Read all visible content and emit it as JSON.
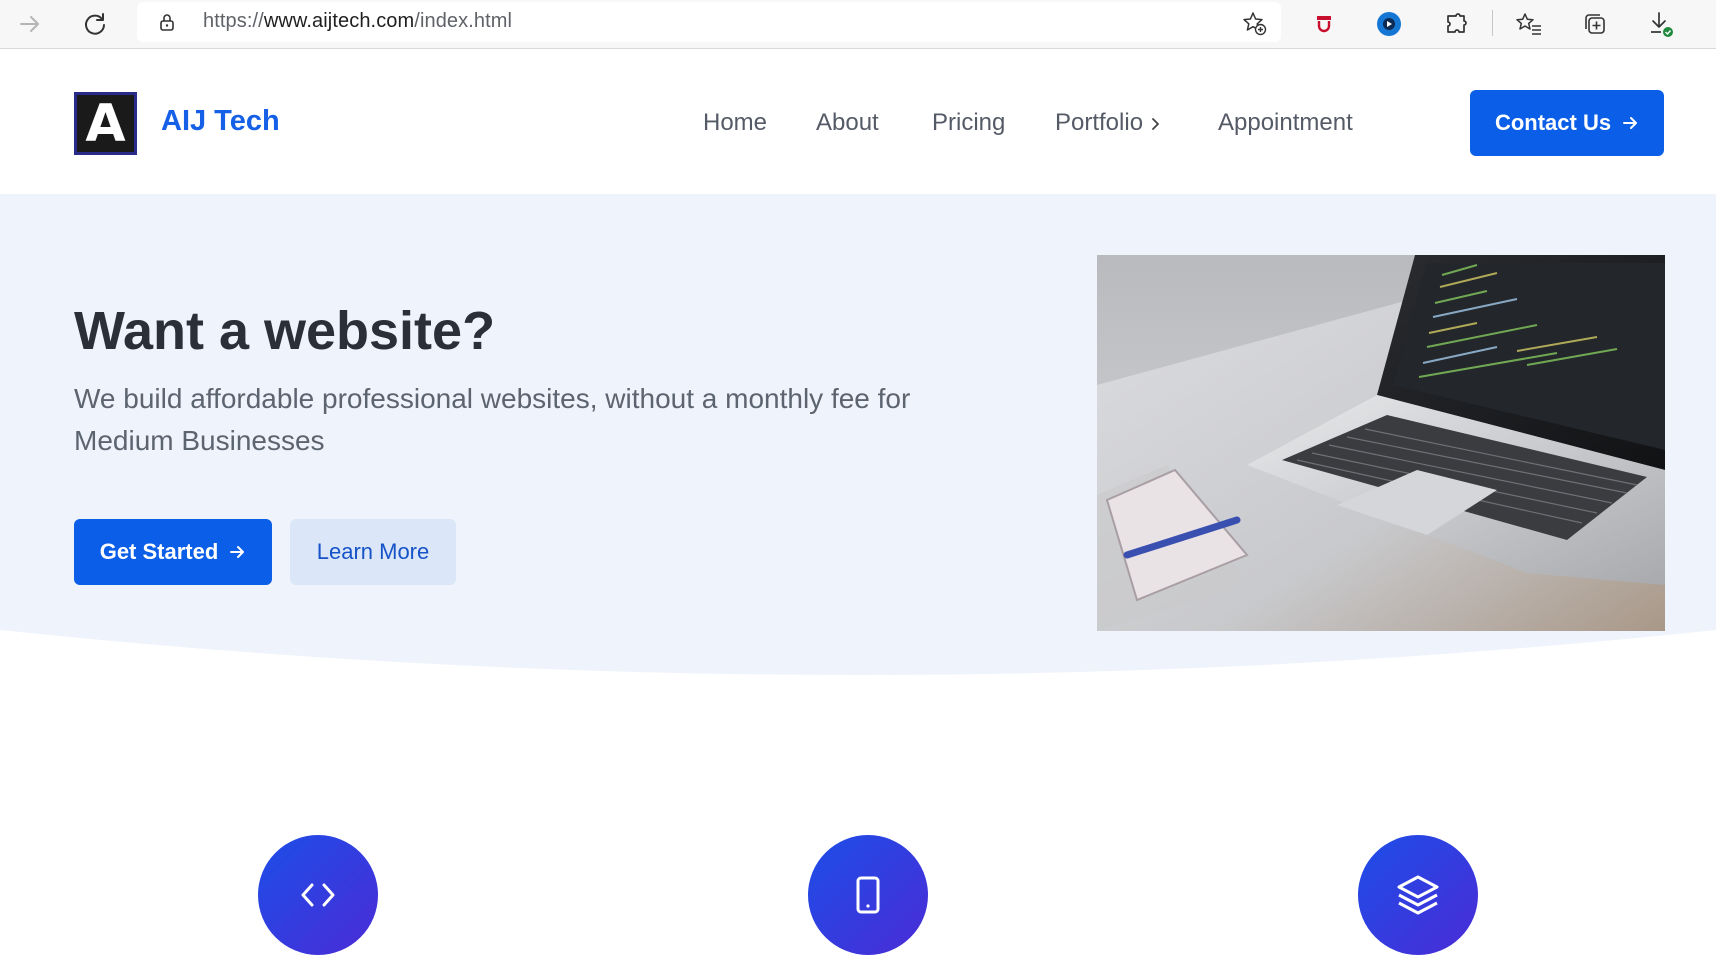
{
  "browser": {
    "url_scheme": "https://",
    "url_host": "www.aijtech.com",
    "url_path": "/index.html"
  },
  "site": {
    "logo_letter": "A",
    "brand_name": "AIJ Tech",
    "menu": [
      {
        "label": "Home"
      },
      {
        "label": "About"
      },
      {
        "label": "Pricing"
      },
      {
        "label": "Portfolio"
      },
      {
        "label": "Appointment"
      }
    ],
    "contact_label": "Contact Us"
  },
  "hero": {
    "title": "Want a website?",
    "subtitle": "We build affordable professional websites, without a monthly fee for Medium Businesses",
    "primary_label": "Get Started",
    "secondary_label": "Learn More"
  },
  "features": [
    {
      "icon": "code-icon"
    },
    {
      "icon": "tablet-icon"
    },
    {
      "icon": "layers-icon"
    }
  ],
  "colors": {
    "accent": "#0b5ee8",
    "hero_bg": "#eff3fb"
  }
}
